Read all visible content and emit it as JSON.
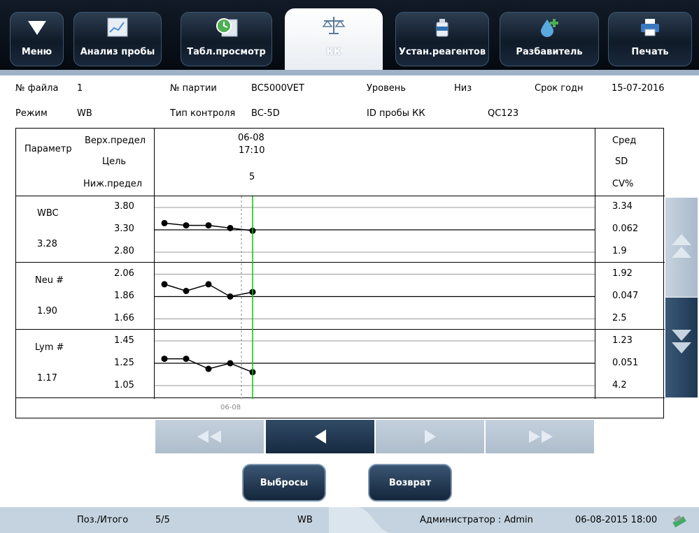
{
  "toolbar": {
    "menu": "Меню",
    "sample_analysis": "Анализ пробы",
    "table_review": "Табл.просмотр",
    "qc": "КК",
    "reagent_setup": "Устан.реагентов",
    "diluent": "Разбавитель",
    "print": "Печать"
  },
  "info": {
    "file_no_label": "№ файла",
    "file_no": "1",
    "lot_label": "№ партии",
    "lot": "BC5000VET",
    "level_label": "Уровень",
    "level": "Низ",
    "expiry_label": "Срок годн",
    "expiry": "15-07-2016",
    "mode_label": "Режим",
    "mode": "WB",
    "control_type_label": "Тип контроля",
    "control_type": "BC-5D",
    "qc_sample_id_label": "ID пробы КК",
    "qc_sample_id": "QC123"
  },
  "table": {
    "header": {
      "param": "Параметр",
      "upper": "Верх.предел",
      "target": "Цель",
      "lower": "Ниж.предел",
      "date": "06-08",
      "time": "17:10",
      "point_no": "5",
      "mean": "Сред",
      "sd": "SD",
      "cv": "CV%"
    },
    "rows": [
      {
        "name": "WBC",
        "value": "3.28",
        "upper": "3.80",
        "target": "3.30",
        "lower": "2.80",
        "mean": "3.34",
        "sd": "0.062",
        "cv": "1.9",
        "points": [
          3.45,
          3.4,
          3.4,
          3.34,
          3.28
        ]
      },
      {
        "name": "Neu #",
        "value": "1.90",
        "upper": "2.06",
        "target": "1.86",
        "lower": "1.66",
        "mean": "1.92",
        "sd": "0.047",
        "cv": "2.5",
        "points": [
          1.97,
          1.91,
          1.97,
          1.86,
          1.9
        ]
      },
      {
        "name": "Lym #",
        "value": "1.17",
        "upper": "1.45",
        "target": "1.25",
        "lower": "1.05",
        "mean": "1.23",
        "sd": "0.051",
        "cv": "4.2",
        "points": [
          1.29,
          1.29,
          1.2,
          1.25,
          1.17
        ]
      }
    ],
    "bottom_date": "06-08"
  },
  "buttons": {
    "outliers": "Выбросы",
    "back": "Возврат"
  },
  "status": {
    "pos_label": "Поз./Итого",
    "pos_value": "5/5",
    "mode": "WB",
    "user": "Администратор : Admin",
    "datetime": "06-08-2015 18:00"
  },
  "colors": {
    "accent_dark": "#1a2e45",
    "cursor_line": "#00cc00",
    "status_bg": "#c5d3e0"
  }
}
